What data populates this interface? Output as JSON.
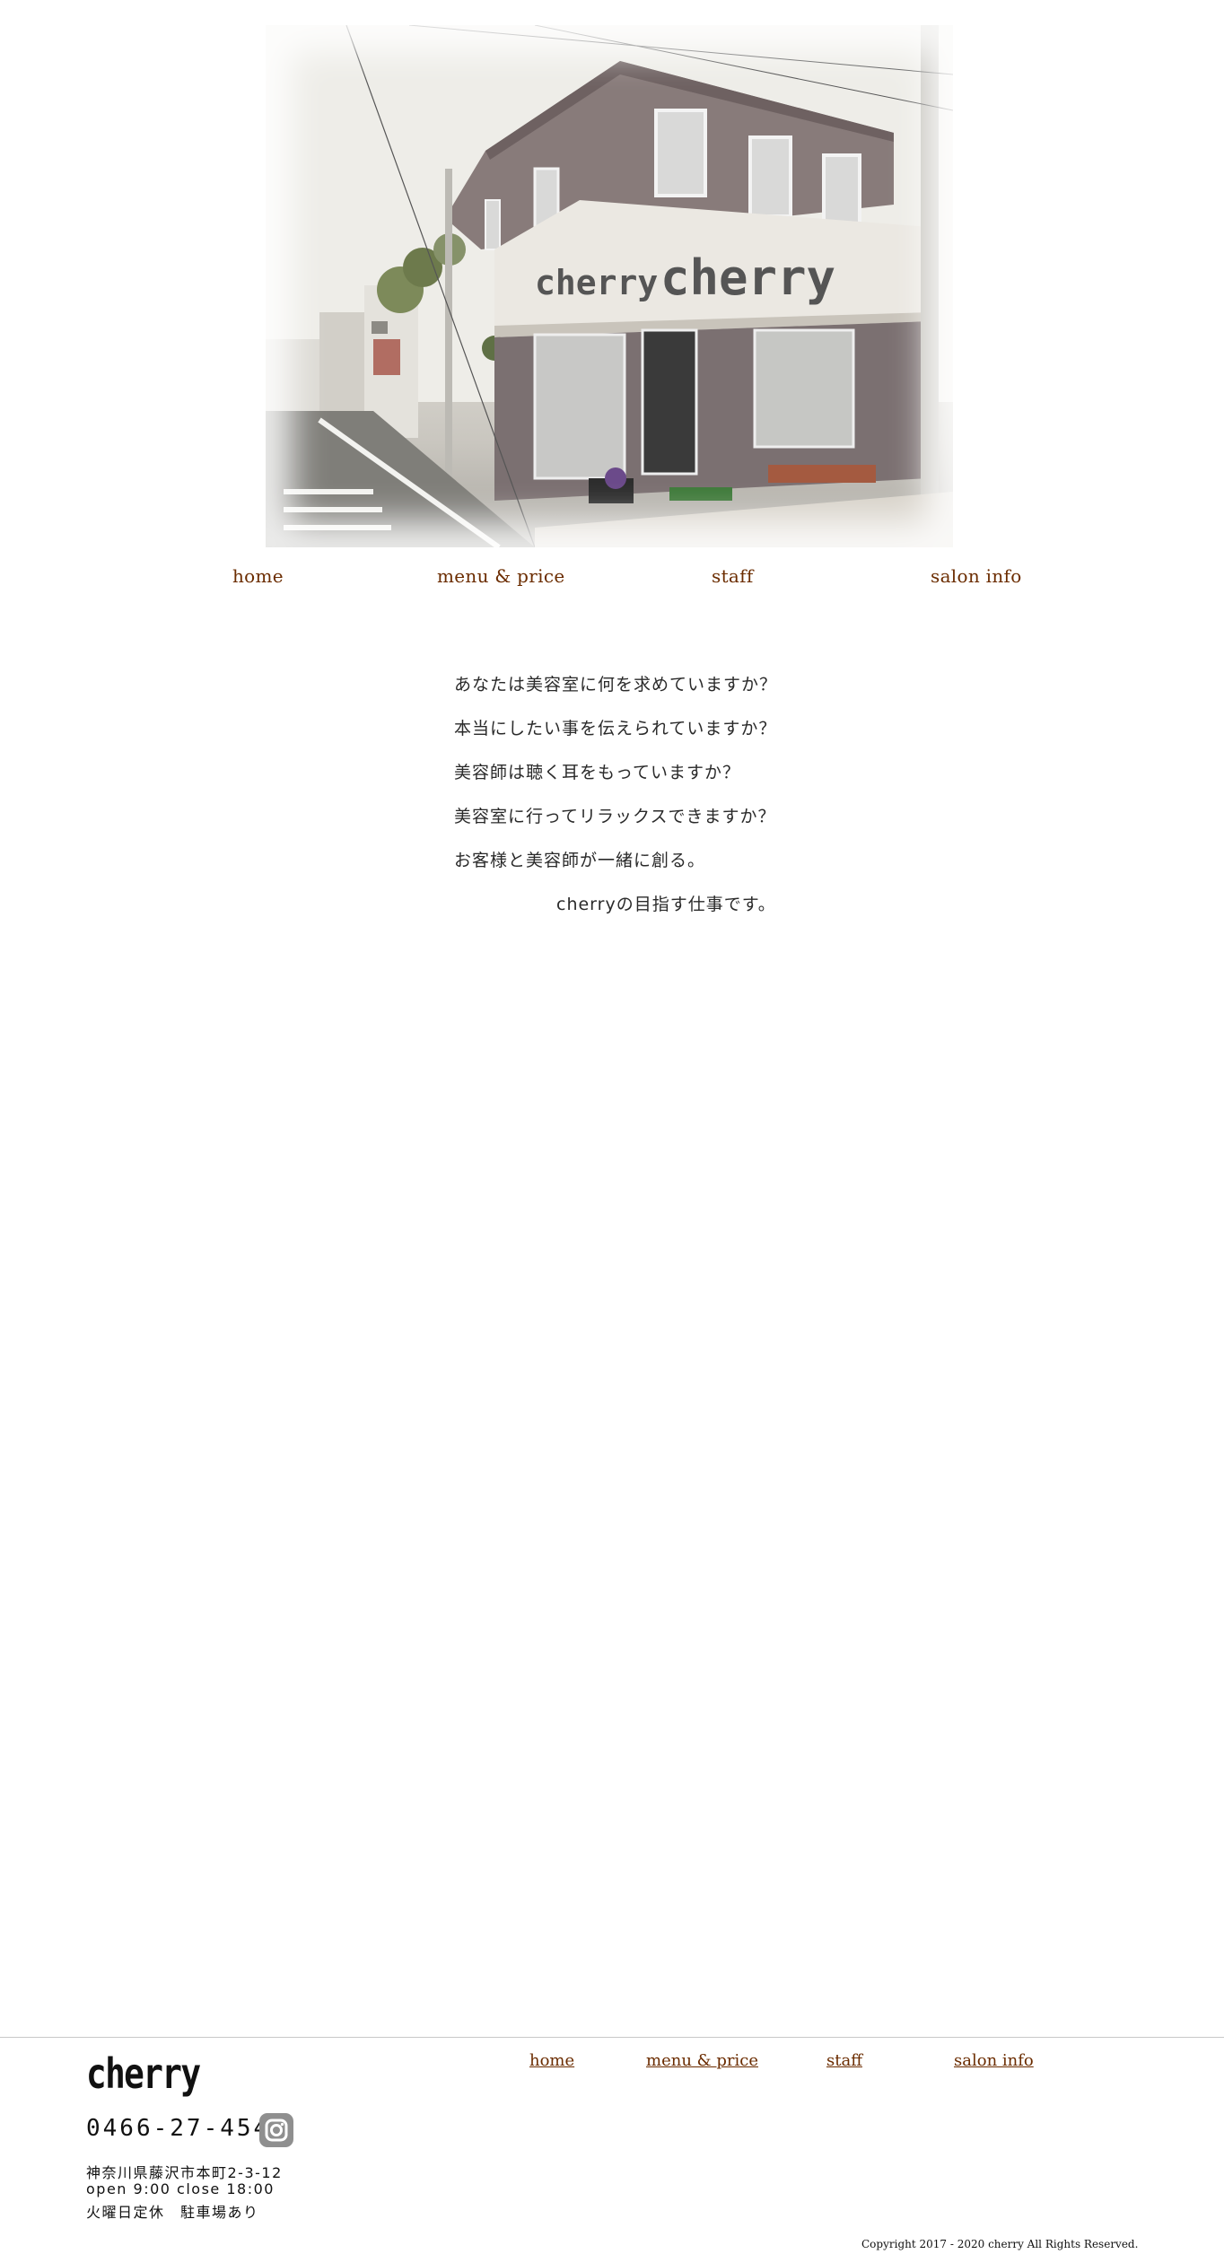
{
  "hero": {
    "image_alt": "cherry salon storefront",
    "sign_text": "cherry"
  },
  "nav": [
    {
      "label": "home"
    },
    {
      "label": "menu & price"
    },
    {
      "label": "staff"
    },
    {
      "label": "salon info"
    }
  ],
  "message": [
    "あなたは美容室に何を求めていますか？",
    "本当にしたい事を伝えられていますか？",
    "美容師は聴く耳をもっていますか？",
    "美容室に行ってリラックスできますか？",
    "お客様と美容師が一緒に創る。",
    "cherryの目指す仕事です。"
  ],
  "footer": {
    "logo": "cherry",
    "phone": "0466-27-4546",
    "instagram_icon": "instagram-icon",
    "address": "神奈川県藤沢市本町2-3-12",
    "hours": "open 9:00 close 18:00",
    "closed": "火曜日定休　駐車場あり",
    "nav": [
      {
        "label": "home"
      },
      {
        "label": "menu & price"
      },
      {
        "label": "staff"
      },
      {
        "label": "salon info"
      }
    ],
    "copyright": "Copyright 2017 - 2020 cherry All Rights Reserved."
  },
  "colors": {
    "link": "#6b2c00",
    "text": "#222222",
    "divider": "#c8c8c8"
  }
}
